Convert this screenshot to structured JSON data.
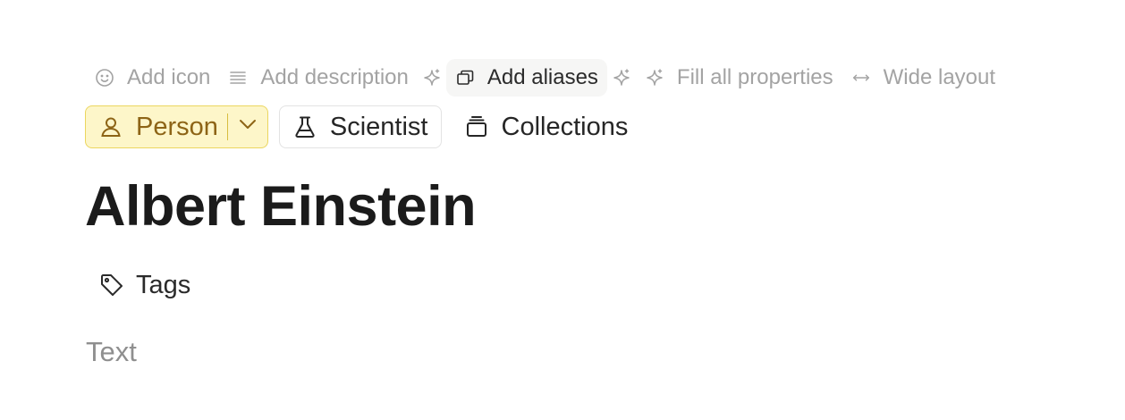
{
  "toolbar": {
    "add_icon": "Add icon",
    "add_description": "Add description",
    "add_aliases": "Add aliases",
    "fill_all_properties": "Fill all properties",
    "wide_layout": "Wide layout"
  },
  "types": {
    "primary": "Person",
    "secondary": "Scientist",
    "collections": "Collections"
  },
  "page": {
    "title": "Albert Einstein",
    "tags_label": "Tags",
    "body_placeholder": "Text"
  },
  "colors": {
    "person_chip_bg": "#fdf6c9",
    "person_chip_border": "#ebd65f",
    "person_chip_text": "#8d6416",
    "muted_text": "#a3a3a3"
  },
  "icons": {
    "add_icon": "smiley-icon",
    "add_description": "lines-icon",
    "sparkle": "sparkle-icon",
    "add_aliases": "windows-icon",
    "wide_layout": "horizontal-arrows-icon",
    "person": "user-icon",
    "scientist": "flask-icon",
    "collections": "stack-icon",
    "tags": "tag-icon",
    "dropdown": "chevron-down-icon"
  }
}
